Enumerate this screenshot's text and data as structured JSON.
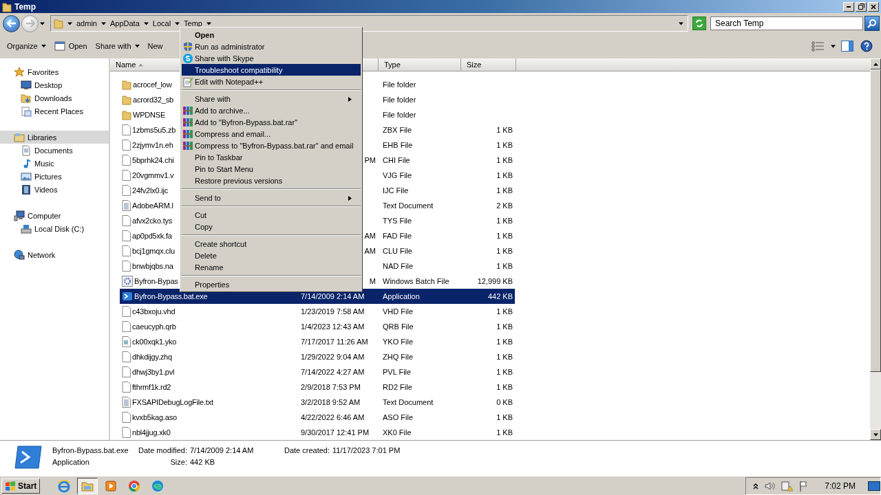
{
  "window": {
    "title": "Temp"
  },
  "address_bar": {
    "back_disabled": false,
    "forward_disabled": true,
    "path": [
      "admin",
      "AppData",
      "Local",
      "Temp"
    ]
  },
  "search": {
    "placeholder": "Search Temp"
  },
  "toolbar": {
    "buttons": [
      {
        "label": "Organize",
        "kind": "menu"
      },
      {
        "label": "Open",
        "kind": "icon"
      },
      {
        "label": "Share with",
        "kind": "menu"
      },
      {
        "label": "New",
        "kind": "plain"
      }
    ]
  },
  "sidebar": {
    "groups": [
      {
        "label": "Favorites",
        "kind": "star",
        "selected": false,
        "children": [
          {
            "label": "Desktop",
            "kind": "desktop",
            "selected": false
          },
          {
            "label": "Downloads",
            "kind": "downloads",
            "selected": false
          },
          {
            "label": "Recent Places",
            "kind": "recent",
            "selected": false
          }
        ]
      },
      {
        "label": "Libraries",
        "kind": "libraries",
        "selected": true,
        "children": [
          {
            "label": "Documents",
            "kind": "documents",
            "selected": false
          },
          {
            "label": "Music",
            "kind": "music",
            "selected": false
          },
          {
            "label": "Pictures",
            "kind": "pictures",
            "selected": false
          },
          {
            "label": "Videos",
            "kind": "videos",
            "selected": false
          }
        ]
      },
      {
        "label": "Computer",
        "kind": "computer",
        "selected": false,
        "children": [
          {
            "label": "Local Disk (C:)",
            "kind": "disk",
            "selected": false
          }
        ]
      },
      {
        "label": "Network",
        "kind": "network",
        "selected": false
      }
    ]
  },
  "table": {
    "columns": [
      {
        "label": "Name",
        "sorted": true
      },
      {
        "label": "Type",
        "sorted": false
      },
      {
        "label": "Size",
        "sorted": false
      }
    ],
    "rows": [
      {
        "name": "acrocef_low",
        "type": "File folder",
        "kind": "folder",
        "selected": false
      },
      {
        "name": "acrord32_sb",
        "type": "File folder",
        "kind": "folder",
        "selected": false
      },
      {
        "name": "WPDNSE",
        "type": "File folder",
        "kind": "folder",
        "selected": false
      },
      {
        "name": "1zbms5u5.zb",
        "type": "ZBX File",
        "size": "1 KB",
        "kind": "file",
        "selected": false
      },
      {
        "name": "2zjymv1n.eh",
        "type": "EHB File",
        "size": "1 KB",
        "kind": "file",
        "selected": false
      },
      {
        "name": "5bprhk24.chi",
        "date_fragment": "PM",
        "type": "CHI File",
        "size": "1 KB",
        "kind": "file",
        "selected": false
      },
      {
        "name": "20vgmmv1.v",
        "type": "VJG File",
        "size": "1 KB",
        "kind": "file",
        "selected": false
      },
      {
        "name": "24fv2lx0.ijc",
        "type": "IJC File",
        "size": "1 KB",
        "kind": "file",
        "selected": false
      },
      {
        "name": "AdobeARM.l",
        "type": "Text Document",
        "size": "2 KB",
        "kind": "text",
        "selected": false
      },
      {
        "name": "afvx2cko.tys",
        "type": "TYS File",
        "size": "1 KB",
        "kind": "file",
        "selected": false
      },
      {
        "name": "ap0pd5xk.fa",
        "date_fragment": "AM",
        "type": "FAD File",
        "size": "1 KB",
        "kind": "file",
        "selected": false
      },
      {
        "name": "bcj1gmqx.clu",
        "date_fragment": "AM",
        "type": "CLU File",
        "size": "1 KB",
        "kind": "file",
        "selected": false
      },
      {
        "name": "bnwbjqbs.na",
        "type": "NAD File",
        "size": "1 KB",
        "kind": "file",
        "selected": false
      },
      {
        "name": "Byfron-Bypas",
        "date_fragment": "M",
        "type": "Windows Batch File",
        "size": "12,999 KB",
        "kind": "batch",
        "selected": false
      },
      {
        "name": "Byfron-Bypass.bat.exe",
        "date": "7/14/2009 2:14 AM",
        "type": "Application",
        "size": "442 KB",
        "kind": "exe",
        "selected": true
      },
      {
        "name": "c43bxoju.vhd",
        "date": "1/23/2019 7:58 AM",
        "type": "VHD File",
        "size": "1 KB",
        "kind": "file",
        "selected": false
      },
      {
        "name": "caeucyph.qrb",
        "date": "1/4/2023 12:43 AM",
        "type": "QRB File",
        "size": "1 KB",
        "kind": "file",
        "selected": false
      },
      {
        "name": "ck00xqk1.yko",
        "date": "7/17/2017 11:26 AM",
        "type": "YKO File",
        "size": "1 KB",
        "kind": "data",
        "selected": false
      },
      {
        "name": "dhkdijgy.zhq",
        "date": "1/29/2022 9:04 AM",
        "type": "ZHQ File",
        "size": "1 KB",
        "kind": "file",
        "selected": false
      },
      {
        "name": "dhwj3by1.pvl",
        "date": "7/14/2022 4:27 AM",
        "type": "PVL File",
        "size": "1 KB",
        "kind": "file",
        "selected": false
      },
      {
        "name": "fthrmf1k.rd2",
        "date": "2/9/2018 7:53 PM",
        "type": "RD2 File",
        "size": "1 KB",
        "kind": "file",
        "selected": false
      },
      {
        "name": "FXSAPIDebugLogFile.txt",
        "date": "3/2/2018 9:52 AM",
        "type": "Text Document",
        "size": "0 KB",
        "kind": "text",
        "selected": false
      },
      {
        "name": "kvxb5kag.aso",
        "date": "4/22/2022 6:46 AM",
        "type": "ASO File",
        "size": "1 KB",
        "kind": "file",
        "selected": false
      },
      {
        "name": "nbl4jjug.xk0",
        "date": "9/30/2017 12:41 PM",
        "type": "XK0 File",
        "size": "1 KB",
        "kind": "file",
        "selected": false
      }
    ]
  },
  "context_menu": {
    "items": [
      {
        "label": "Open",
        "kind": "default",
        "selected": false
      },
      {
        "label": "Run as administrator",
        "kind": "shield",
        "selected": false
      },
      {
        "label": "Share with Skype",
        "kind": "skype",
        "selected": false
      },
      {
        "label": "Troubleshoot compatibility",
        "kind": "plain",
        "selected": true
      },
      {
        "label": "Edit with Notepad++",
        "kind": "notepad",
        "selected": false
      },
      {
        "kind": "separator"
      },
      {
        "label": "Share with",
        "kind": "submenu",
        "selected": false
      },
      {
        "label": "Add to archive...",
        "kind": "winrar",
        "selected": false
      },
      {
        "label": "Add to \"Byfron-Bypass.bat.rar\"",
        "kind": "winrar",
        "selected": false
      },
      {
        "label": "Compress and email...",
        "kind": "winrar",
        "selected": false
      },
      {
        "label": "Compress to \"Byfron-Bypass.bat.rar\" and email",
        "kind": "winrar",
        "selected": false
      },
      {
        "label": "Pin to Taskbar",
        "kind": "plain",
        "selected": false
      },
      {
        "label": "Pin to Start Menu",
        "kind": "plain",
        "selected": false
      },
      {
        "label": "Restore previous versions",
        "kind": "plain",
        "selected": false
      },
      {
        "kind": "separator"
      },
      {
        "label": "Send to",
        "kind": "submenu",
        "selected": false
      },
      {
        "kind": "separator"
      },
      {
        "label": "Cut",
        "kind": "plain",
        "selected": false
      },
      {
        "label": "Copy",
        "kind": "plain",
        "selected": false
      },
      {
        "kind": "separator"
      },
      {
        "label": "Create shortcut",
        "kind": "plain",
        "selected": false
      },
      {
        "label": "Delete",
        "kind": "plain",
        "selected": false
      },
      {
        "label": "Rename",
        "kind": "plain",
        "selected": false
      },
      {
        "kind": "separator"
      },
      {
        "label": "Properties",
        "kind": "plain",
        "selected": false
      }
    ]
  },
  "details": {
    "name": "Byfron-Bypass.bat.exe",
    "type": "Application",
    "fields": [
      {
        "label": "Date modified:",
        "value": "7/14/2009 2:14 AM"
      },
      {
        "label": "Size:",
        "value": "442 KB"
      },
      {
        "label": "Date created:",
        "value": "11/17/2023 7:01 PM"
      }
    ]
  },
  "taskbar": {
    "start": "Start",
    "apps": [
      {
        "kind": "ie",
        "selected": false
      },
      {
        "kind": "explorer",
        "selected": true
      },
      {
        "kind": "media",
        "selected": false
      },
      {
        "kind": "chrome",
        "selected": false
      },
      {
        "kind": "edge",
        "selected": false
      }
    ],
    "clock": "7:02 PM"
  }
}
